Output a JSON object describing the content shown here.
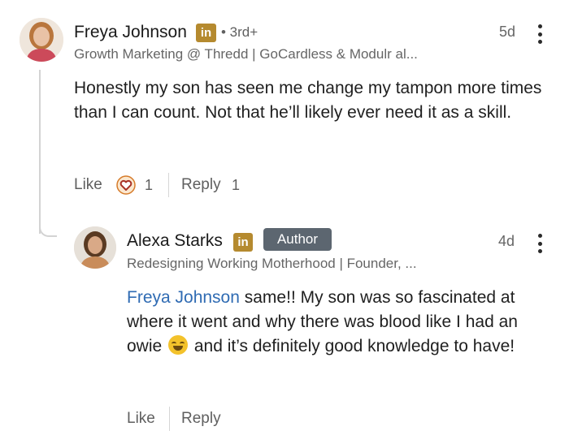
{
  "comment": {
    "author_name": "Freya Johnson",
    "linkedin_badge": "in",
    "degree": "• 3rd+",
    "headline": "Growth Marketing @ Thredd | GoCardless & Modulr al...",
    "time": "5d",
    "body": "Honestly my son has seen me change my tampon more times than I can count. Not that he’ll likely ever need it as a skill.",
    "like_label": "Like",
    "reaction_count": "1",
    "reply_label": "Reply",
    "reply_count": "1",
    "reaction_icon": "heart-reaction-icon"
  },
  "reply": {
    "author_name": "Alexa Starks",
    "linkedin_badge": "in",
    "author_badge": "Author",
    "headline": "Redesigning Working Motherhood | Founder, ...",
    "time": "4d",
    "mention": "Freya Johnson",
    "body_part1": " same!! My son was so fascinated at where it went and why there was blood like I had an owie ",
    "emoji": "rolling-on-floor-laughing-emoji",
    "body_part2": " and it’s definitely good knowledge to have!",
    "like_label": "Like",
    "reply_label": "Reply"
  },
  "colors": {
    "linkedin_badge": "#b58a2f",
    "author_badge": "#5c6670",
    "mention": "#2f6bb3",
    "reaction_heart": "#c0392b"
  }
}
